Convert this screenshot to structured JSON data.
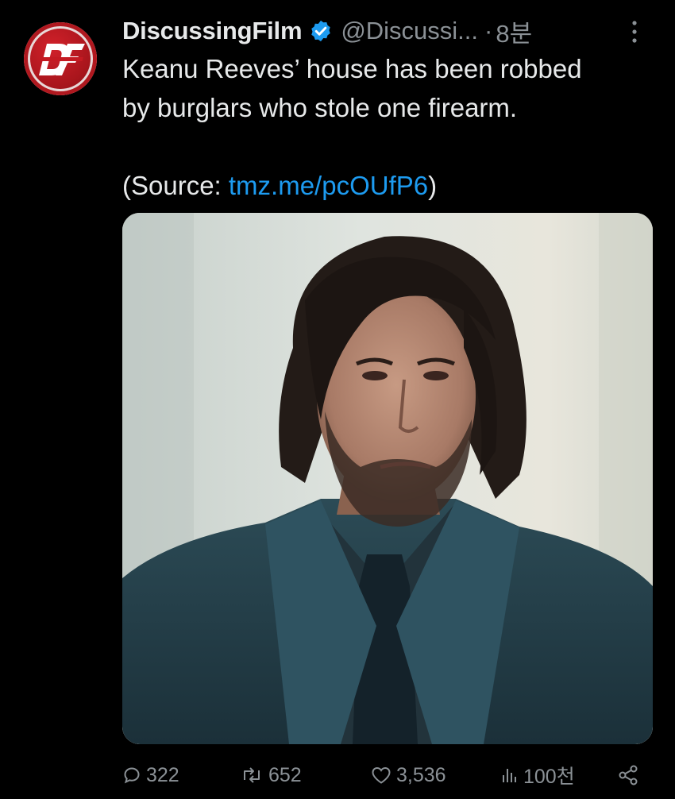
{
  "account": {
    "display_name": "DiscussingFilm",
    "handle": "@Discussi...",
    "separator": "·",
    "time": "8분",
    "avatar_logo": "DF",
    "brand_color": "#c41a22",
    "verified_color": "#1d9bf0"
  },
  "post": {
    "line1": "Keanu Reeves’ house has been robbed",
    "line2": "by burglars who stole one firearm.",
    "source_prefix": "(Source: ",
    "source_link": "tmz.me/pcOUfP6",
    "source_suffix": ")",
    "link_color": "#1d9bf0"
  },
  "media": {
    "icon": "photo-of-man-in-dark-suit"
  },
  "actions": {
    "reply": {
      "icon": "reply-icon",
      "count": "322"
    },
    "repost": {
      "icon": "repost-icon",
      "count": "652"
    },
    "like": {
      "icon": "heart-icon",
      "count": "3,536"
    },
    "views": {
      "icon": "views-icon",
      "count": "100천"
    },
    "share": {
      "icon": "share-icon"
    }
  }
}
